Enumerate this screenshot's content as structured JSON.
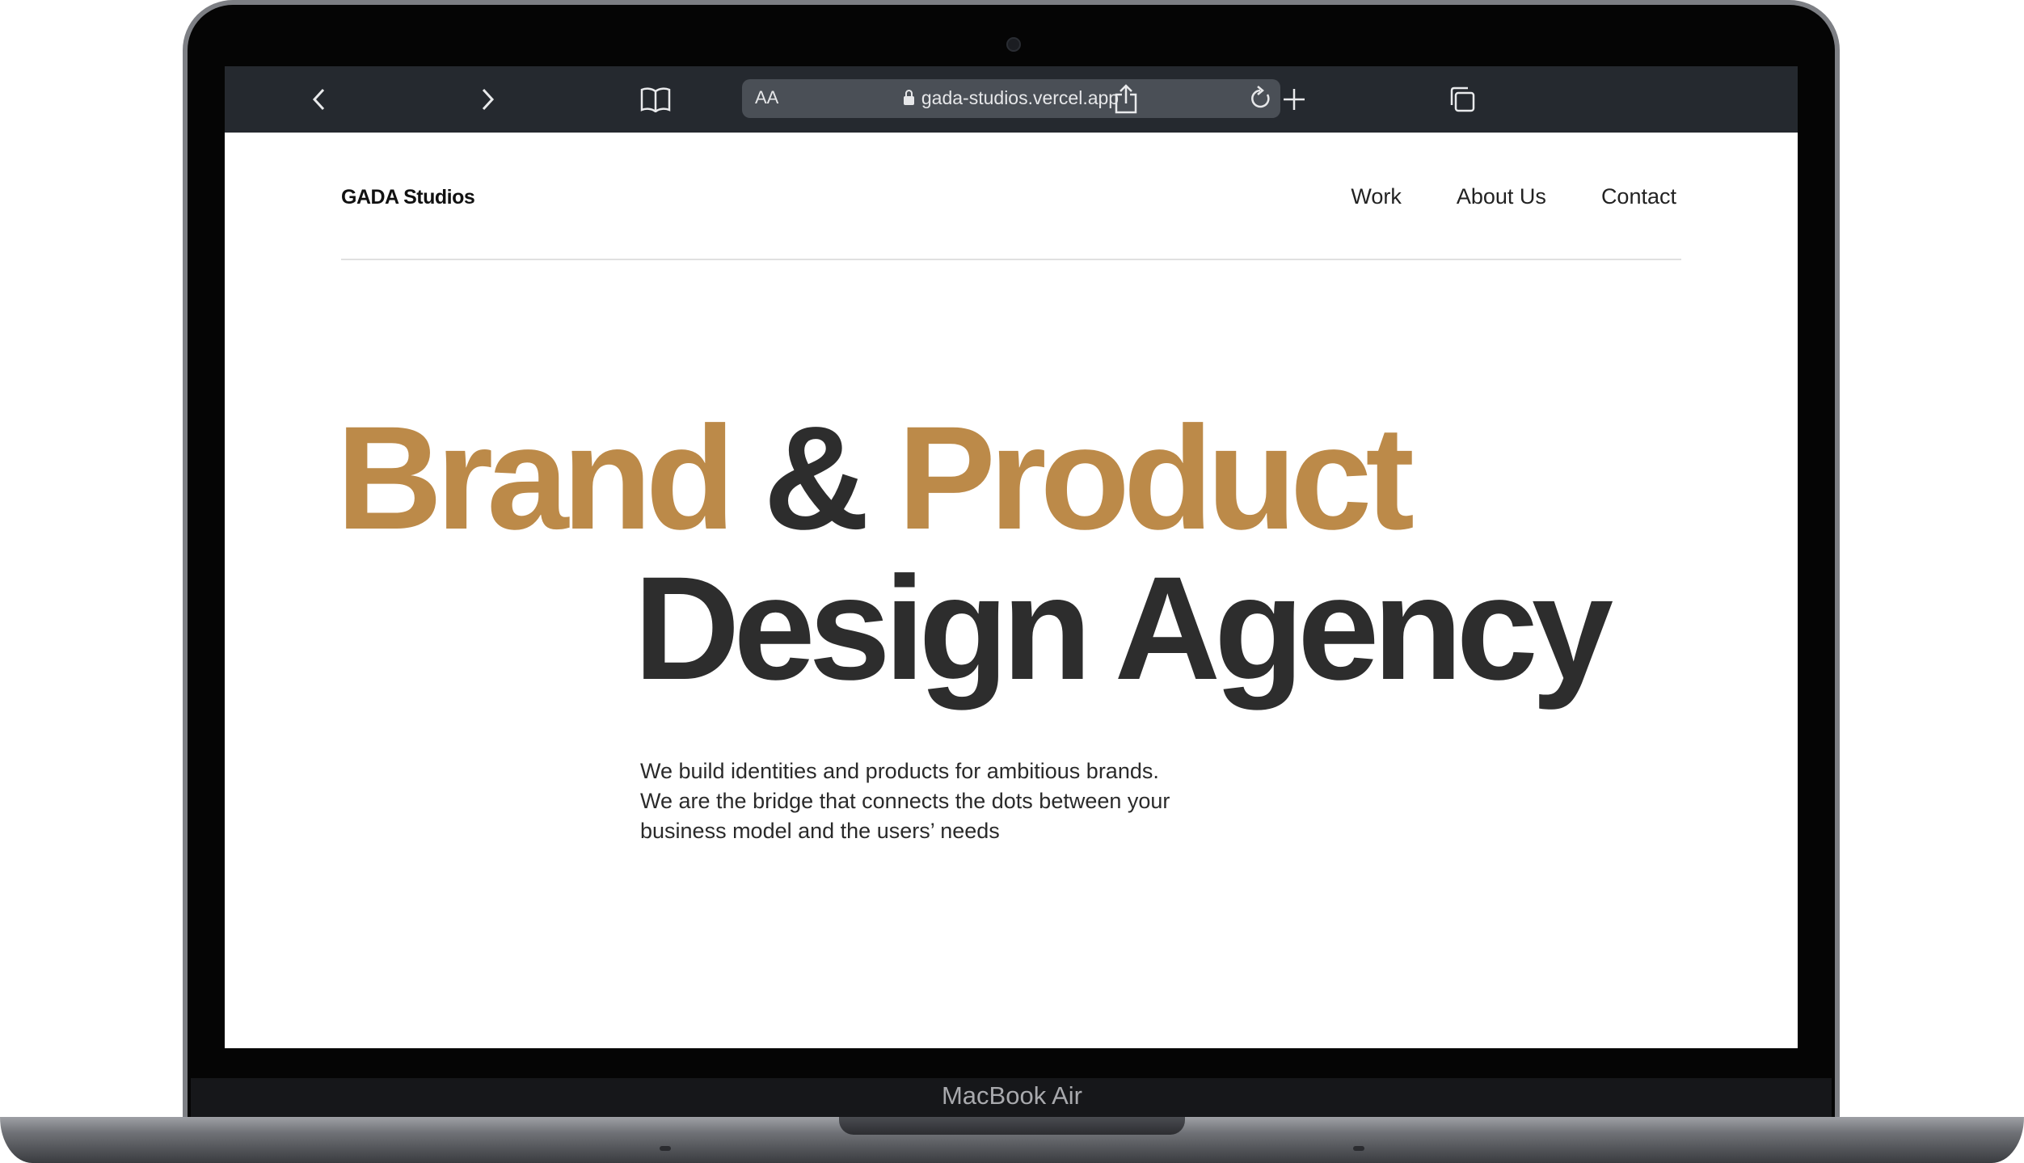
{
  "browser": {
    "text_size_label": "AA",
    "url": "gada-studios.vercel.app",
    "back_icon": "chevron-left-icon",
    "forward_icon": "chevron-right-icon",
    "bookmarks_icon": "book-icon",
    "reload_icon": "reload-icon",
    "share_icon": "share-icon",
    "new_tab_icon": "plus-icon",
    "tabs_icon": "tabs-icon",
    "toolbar_color": "#25292f"
  },
  "site": {
    "logo": "GADA Studios",
    "nav": [
      "Work",
      "About Us",
      "Contact"
    ]
  },
  "hero": {
    "line1_word1": "Brand",
    "line1_amp": "&",
    "line1_word2": "Product",
    "line2": "Design Agency",
    "accent_color": "#bc8a49",
    "dark_color": "#2d2d2d"
  },
  "tagline": {
    "lines": [
      "We build identities and products for ambitious brands.",
      "We are the bridge that connects the dots between your",
      "business model and the users’ needs"
    ]
  },
  "device": {
    "label": "MacBook Air"
  }
}
